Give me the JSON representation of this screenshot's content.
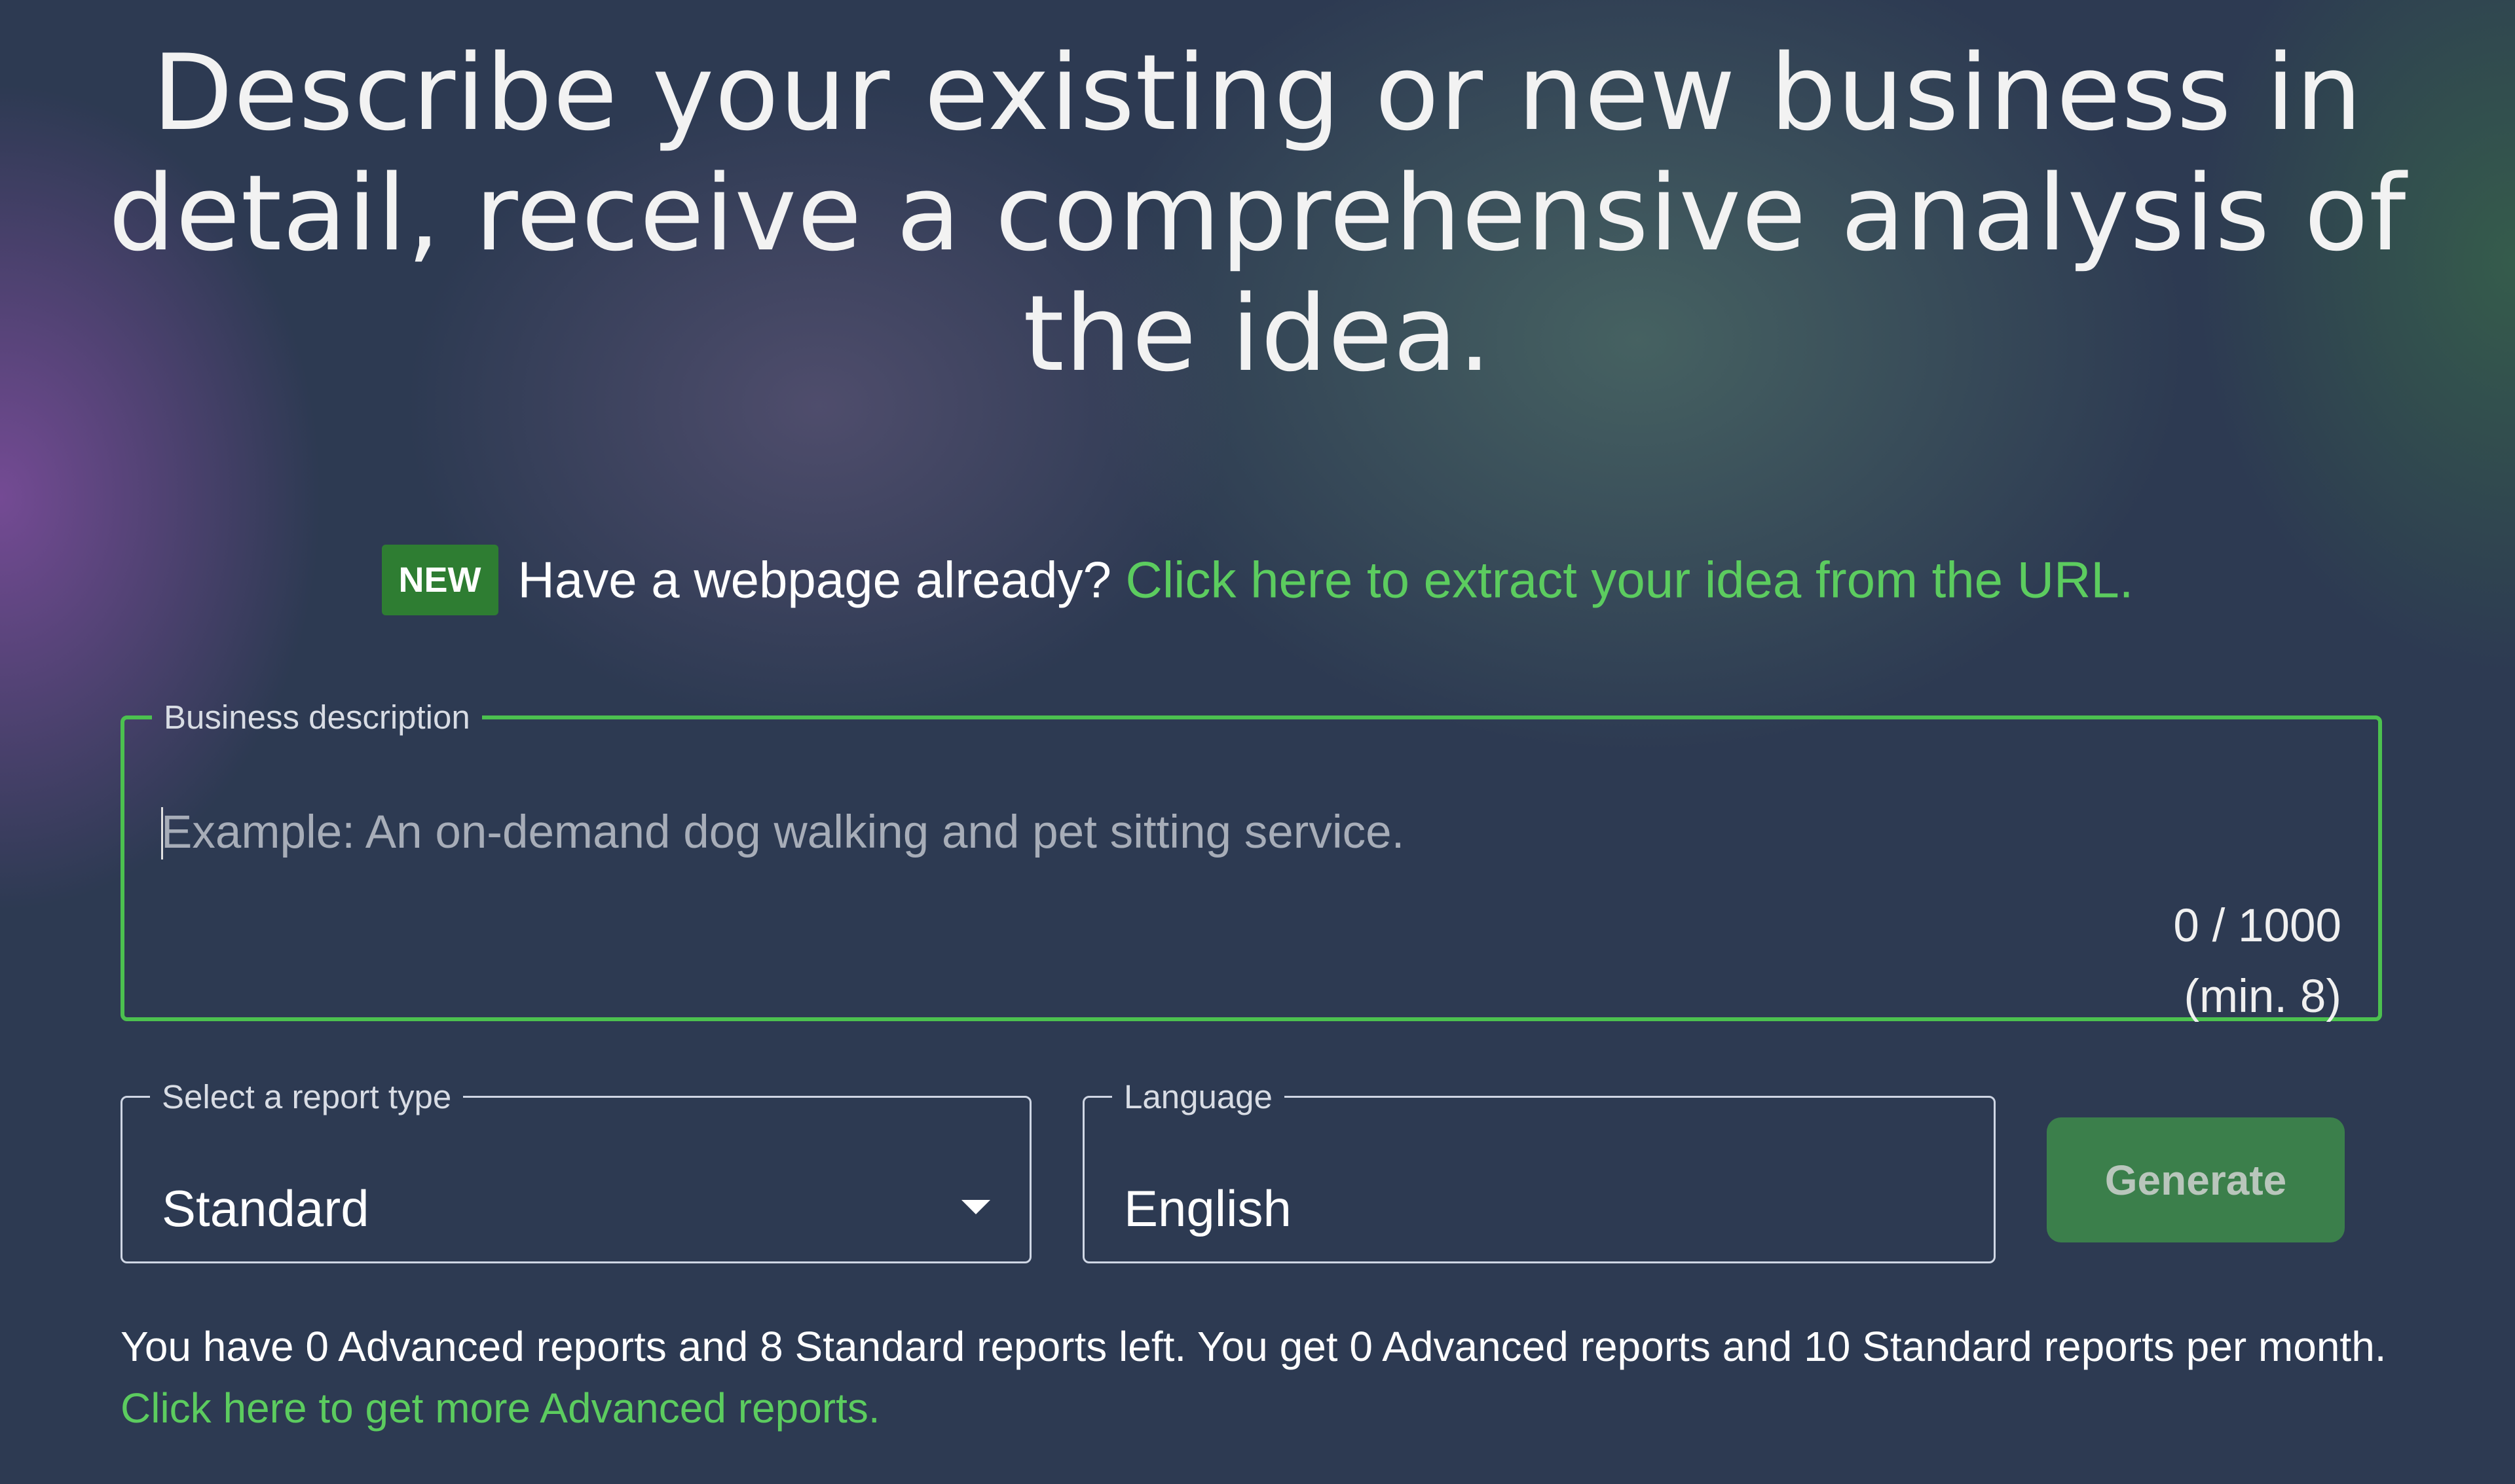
{
  "heading": "Describe your existing or new business in detail, receive a comprehensive analysis of the idea.",
  "promo": {
    "badge": "NEW",
    "text": "Have a webpage already?",
    "link": "Click here to extract your idea from the URL."
  },
  "description": {
    "label": "Business description",
    "placeholder": "Example: An on-demand dog walking and pet sitting service.",
    "counter": "0 / 1000",
    "min": "(min. 8)"
  },
  "report_type": {
    "label": "Select a report type",
    "value": "Standard"
  },
  "language": {
    "label": "Language",
    "value": "English"
  },
  "generate_label": "Generate",
  "footer": {
    "text": "You have 0 Advanced reports and 8 Standard reports left. You get 0 Advanced reports and 10 Standard reports per month.",
    "link": "Click here to get more Advanced reports."
  },
  "colors": {
    "accent": "#4cc14f",
    "background": "#2d3a52",
    "button": "#3b7f4b"
  }
}
